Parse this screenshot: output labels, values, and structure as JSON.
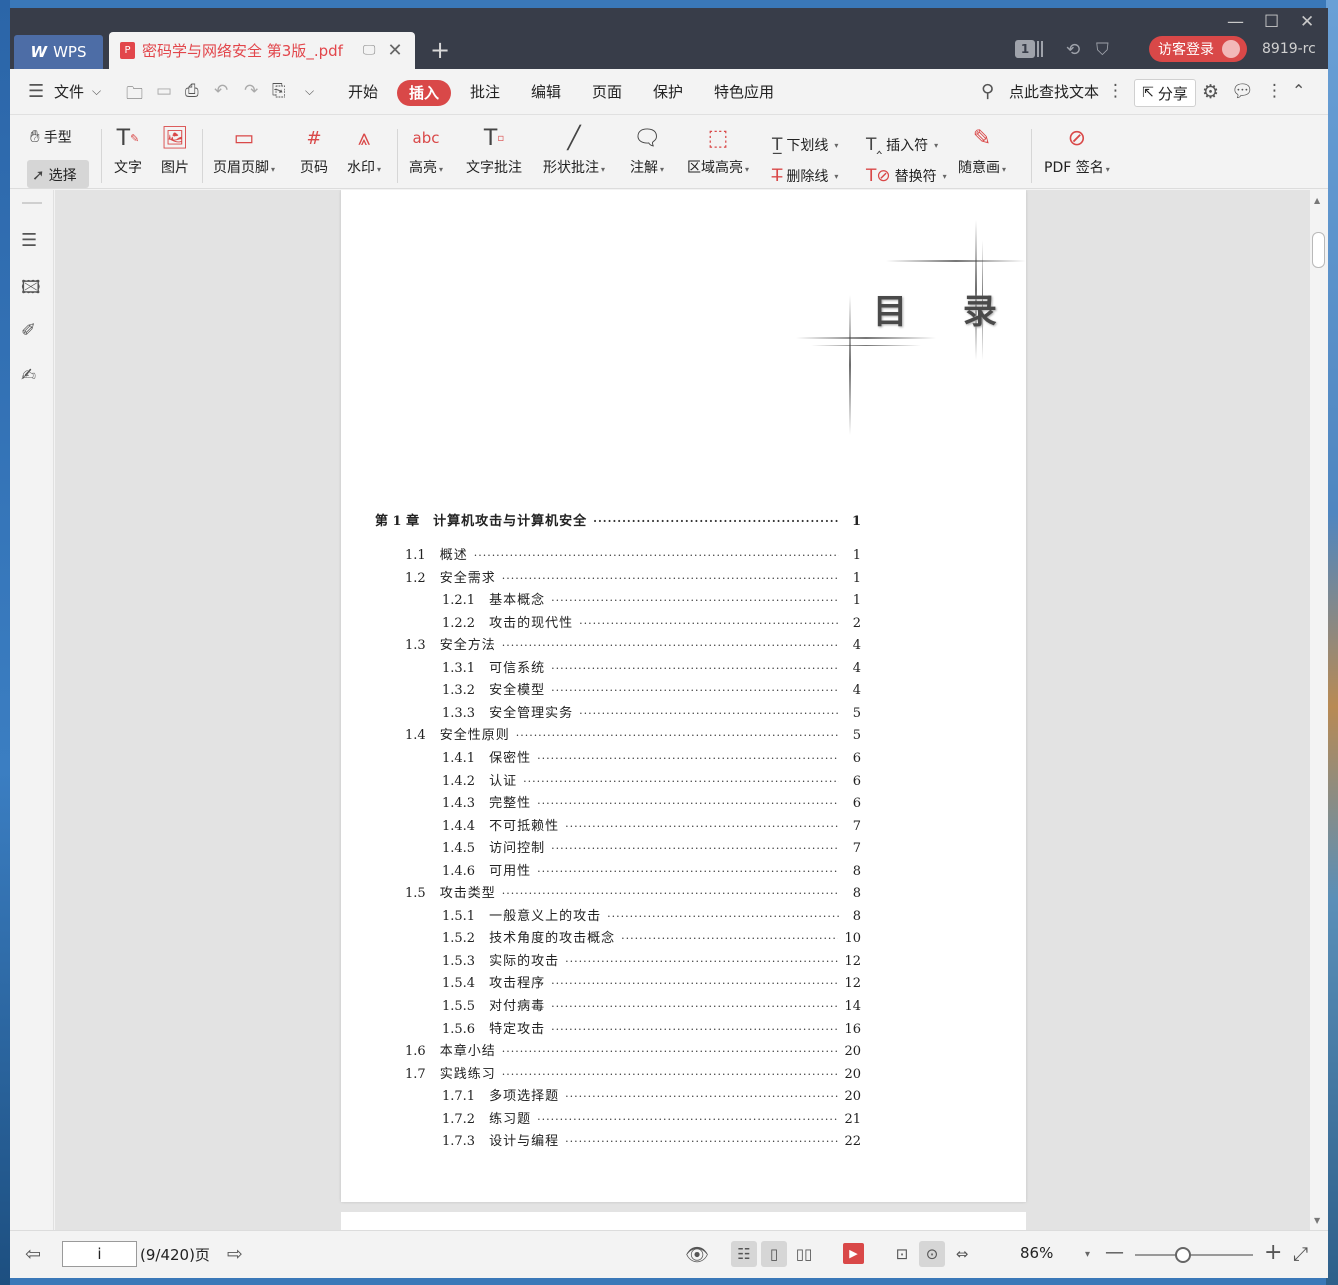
{
  "titlebar": {
    "app_tab": "WPS",
    "doc_tab_title": "密码学与网络安全 第3版_.pdf",
    "tab_count": "1",
    "login_label": "访客登录",
    "user_id": "8919-rc"
  },
  "menu": {
    "file_label": "文件",
    "items": [
      "开始",
      "插入",
      "批注",
      "编辑",
      "页面",
      "保护",
      "特色应用"
    ],
    "active": "插入",
    "search_label": "点此查找文本",
    "share_label": "分享"
  },
  "toolbar": {
    "hand_label": "手型",
    "select_label": "选择",
    "text_label": "文字",
    "image_label": "图片",
    "header_footer_label": "页眉页脚",
    "page_number_label": "页码",
    "watermark_label": "水印",
    "highlight_label": "高亮",
    "text_comment_label": "文字批注",
    "shape_comment_label": "形状批注",
    "note_label": "注解",
    "area_highlight_label": "区域高亮",
    "underline_label": "下划线",
    "strikethrough_label": "删除线",
    "insert_mark_label": "插入符",
    "replace_mark_label": "替换符",
    "freehand_label": "随意画",
    "pdf_sign_label": "PDF 签名"
  },
  "document": {
    "heading": "目 录",
    "toc": [
      {
        "num": "第 1 章",
        "title": "计算机攻击与计算机安全",
        "page": "1",
        "level": 0
      },
      {
        "num": "1.1",
        "title": "概述",
        "page": "1",
        "level": 1
      },
      {
        "num": "1.2",
        "title": "安全需求",
        "page": "1",
        "level": 1
      },
      {
        "num": "1.2.1",
        "title": "基本概念",
        "page": "1",
        "level": 2
      },
      {
        "num": "1.2.2",
        "title": "攻击的现代性",
        "page": "2",
        "level": 2
      },
      {
        "num": "1.3",
        "title": "安全方法",
        "page": "4",
        "level": 1
      },
      {
        "num": "1.3.1",
        "title": "可信系统",
        "page": "4",
        "level": 2
      },
      {
        "num": "1.3.2",
        "title": "安全模型",
        "page": "4",
        "level": 2
      },
      {
        "num": "1.3.3",
        "title": "安全管理实务",
        "page": "5",
        "level": 2
      },
      {
        "num": "1.4",
        "title": "安全性原则",
        "page": "5",
        "level": 1
      },
      {
        "num": "1.4.1",
        "title": "保密性",
        "page": "6",
        "level": 2
      },
      {
        "num": "1.4.2",
        "title": "认证",
        "page": "6",
        "level": 2
      },
      {
        "num": "1.4.3",
        "title": "完整性",
        "page": "6",
        "level": 2
      },
      {
        "num": "1.4.4",
        "title": "不可抵赖性",
        "page": "7",
        "level": 2
      },
      {
        "num": "1.4.5",
        "title": "访问控制",
        "page": "7",
        "level": 2
      },
      {
        "num": "1.4.6",
        "title": "可用性",
        "page": "8",
        "level": 2
      },
      {
        "num": "1.5",
        "title": "攻击类型",
        "page": "8",
        "level": 1
      },
      {
        "num": "1.5.1",
        "title": "一般意义上的攻击",
        "page": "8",
        "level": 2
      },
      {
        "num": "1.5.2",
        "title": "技术角度的攻击概念",
        "page": "10",
        "level": 2
      },
      {
        "num": "1.5.3",
        "title": "实际的攻击",
        "page": "12",
        "level": 2
      },
      {
        "num": "1.5.4",
        "title": "攻击程序",
        "page": "12",
        "level": 2
      },
      {
        "num": "1.5.5",
        "title": "对付病毒",
        "page": "14",
        "level": 2
      },
      {
        "num": "1.5.6",
        "title": "特定攻击",
        "page": "16",
        "level": 2
      },
      {
        "num": "1.6",
        "title": "本章小结",
        "page": "20",
        "level": 1
      },
      {
        "num": "1.7",
        "title": "实践练习",
        "page": "20",
        "level": 1
      },
      {
        "num": "1.7.1",
        "title": "多项选择题",
        "page": "20",
        "level": 2
      },
      {
        "num": "1.7.2",
        "title": "练习题",
        "page": "21",
        "level": 2
      },
      {
        "num": "1.7.3",
        "title": "设计与编程",
        "page": "22",
        "level": 2
      }
    ]
  },
  "status": {
    "page_input": "i",
    "page_info": "(9/420)页",
    "zoom": "86%"
  },
  "colors": {
    "accent": "#d94848",
    "titlebar": "#383d49",
    "wps_tab": "#4d6da6"
  }
}
